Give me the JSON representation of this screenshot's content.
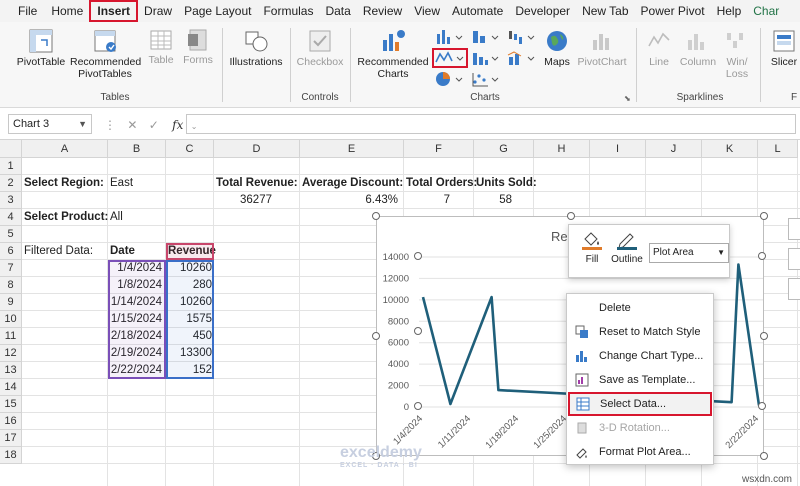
{
  "menu": {
    "tabs": [
      "File",
      "Home",
      "Insert",
      "Draw",
      "Page Layout",
      "Formulas",
      "Data",
      "Review",
      "View",
      "Automate",
      "Developer",
      "New Tab",
      "Power Pivot",
      "Help",
      "Char"
    ]
  },
  "ribbon": {
    "pivottable": "PivotTable",
    "recommended_pivottables_1": "Recommended",
    "recommended_pivottables_2": "PivotTables",
    "table": "Table",
    "forms": "Forms",
    "tables_group": "Tables",
    "illustrations": "Illustrations",
    "checkbox": "Checkbox",
    "controls_group": "Controls",
    "recommended_charts_1": "Recommended",
    "recommended_charts_2": "Charts",
    "maps": "Maps",
    "pivotchart": "PivotChart",
    "charts_group": "Charts",
    "line": "Line",
    "column": "Column",
    "winloss_1": "Win/",
    "winloss_2": "Loss",
    "sparklines_group": "Sparklines",
    "slicer": "Slicer",
    "f_group": "F"
  },
  "formula_bar": {
    "name_box": "Chart 3",
    "fx": "fx"
  },
  "columns": [
    "A",
    "B",
    "C",
    "D",
    "E",
    "F",
    "G",
    "H",
    "I",
    "J",
    "K",
    "L"
  ],
  "rows": [
    "1",
    "2",
    "3",
    "4",
    "5",
    "6",
    "7",
    "8",
    "9",
    "10",
    "11",
    "12",
    "13",
    "14",
    "15",
    "16",
    "17",
    "18"
  ],
  "sheet": {
    "select_region_label": "Select Region:",
    "select_region_value": "East",
    "select_product_label": "Select Product:",
    "select_product_value": "All",
    "filtered_data_label": "Filtered Data:",
    "date_header": "Date",
    "revenue_header": "Revenue",
    "total_revenue_label": "Total Revenue:",
    "total_revenue_value": "36277",
    "avg_discount_label": "Average Discount:",
    "avg_discount_value": "6.43%",
    "total_orders_label": "Total Orders:",
    "total_orders_value": "7",
    "units_sold_label": "Units Sold:",
    "units_sold_value": "58",
    "table_rows": [
      {
        "date": "1/4/2024",
        "revenue": "10260"
      },
      {
        "date": "1/8/2024",
        "revenue": "280"
      },
      {
        "date": "1/14/2024",
        "revenue": "10260"
      },
      {
        "date": "1/15/2024",
        "revenue": "1575"
      },
      {
        "date": "2/18/2024",
        "revenue": "450"
      },
      {
        "date": "2/19/2024",
        "revenue": "13300"
      },
      {
        "date": "2/22/2024",
        "revenue": "152"
      }
    ]
  },
  "chart": {
    "title_partial": "Re",
    "series_color": "#1f5f7a",
    "y_ticks": [
      "14000",
      "12000",
      "10000",
      "8000",
      "6000",
      "4000",
      "2000",
      "0"
    ],
    "x_ticks": [
      "1/4/2024",
      "1/11/2024",
      "1/18/2024",
      "1/25/2024",
      "2/22/2024"
    ]
  },
  "mini_toolbar": {
    "fill": "Fill",
    "outline": "Outline",
    "selector": "Plot Area"
  },
  "context_menu": {
    "items": [
      "Delete",
      "Reset to Match Style",
      "Change Chart Type...",
      "Save as Template...",
      "Select Data...",
      "3-D Rotation...",
      "Format Plot Area..."
    ]
  },
  "watermark": {
    "brand": "exceldemy",
    "tagline": "EXCEL · DATA · BI",
    "site": "wsxdn.com"
  },
  "colors": {
    "highlight": "#d7162e",
    "excel_green": "#217346",
    "series": "#1f5f7a"
  }
}
